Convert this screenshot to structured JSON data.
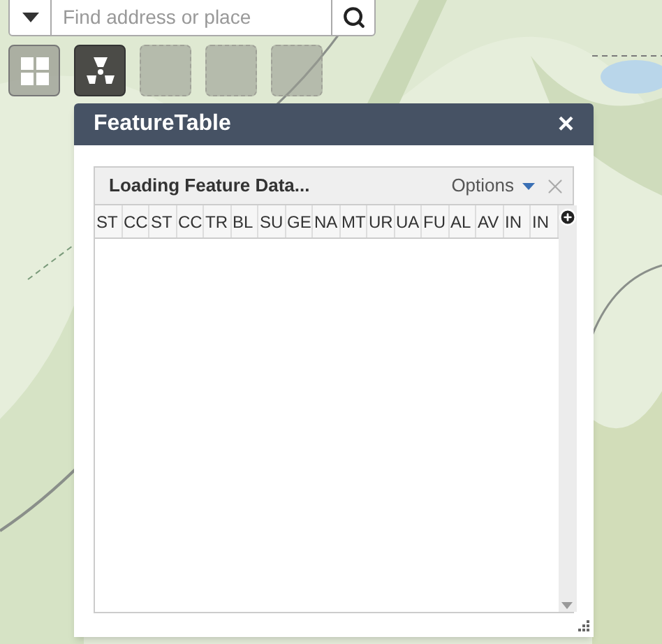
{
  "search": {
    "placeholder": "Find address or place"
  },
  "tool_buttons": [
    {
      "kind": "grid",
      "selected": false,
      "disabled": false
    },
    {
      "kind": "radiation",
      "selected": true,
      "disabled": false
    },
    {
      "kind": "blank",
      "selected": false,
      "disabled": true
    },
    {
      "kind": "blank",
      "selected": false,
      "disabled": true
    },
    {
      "kind": "blank",
      "selected": false,
      "disabled": true
    }
  ],
  "dialog": {
    "title": "FeatureTable",
    "close": "×",
    "table": {
      "status": "Loading Feature Data...",
      "options_label": "Options",
      "columns": [
        "ST",
        "CC",
        "ST",
        "CC",
        "TR",
        "BL",
        "SU",
        "GE",
        "NA",
        "MT",
        "UR",
        "UA",
        "FU",
        "AL",
        "AV",
        "IN",
        "IN"
      ]
    }
  }
}
